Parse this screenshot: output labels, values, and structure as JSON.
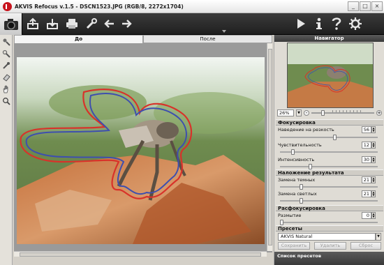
{
  "window": {
    "title": "AKVIS Refocus v.1.5 - DSCN1523.JPG (RGB/8, 2272x1704)",
    "buttons": [
      "_",
      "□",
      "×"
    ]
  },
  "toolbar": {
    "icons": [
      "camera-logo",
      "open-icon",
      "save-icon",
      "print-icon",
      "preferences-icon",
      "undo-icon",
      "redo-icon",
      "run-icon",
      "info-icon",
      "help-icon",
      "settings-icon"
    ]
  },
  "tabs": {
    "before": "До",
    "after": "После"
  },
  "navigator": {
    "title": "Навигатор",
    "zoom": "26%",
    "zoom_minus": "-",
    "zoom_plus": "+"
  },
  "focus": {
    "title": "Фокусировка",
    "params": [
      {
        "label": "Наведение на резкость",
        "value": "56",
        "level": 0.56
      },
      {
        "label": "Чувствительность",
        "value": "12",
        "level": 0.12
      },
      {
        "label": "Интенсивность",
        "value": "30",
        "level": 0.3
      }
    ]
  },
  "overlay": {
    "title": "Наложение результата",
    "params": [
      {
        "label": "Замена темных",
        "value": "21",
        "level": 0.21
      },
      {
        "label": "Замена светлых",
        "value": "21",
        "level": 0.21
      }
    ]
  },
  "defocus": {
    "title": "Расфокусировка",
    "params": [
      {
        "label": "Размытие",
        "value": "0",
        "level": 0.0
      }
    ]
  },
  "presets": {
    "title": "Пресеты",
    "selected": "AKVIS Natural",
    "save": "Сохранить",
    "delete": "Удалить",
    "reset": "Сброс",
    "list_title": "Список пресетов"
  }
}
